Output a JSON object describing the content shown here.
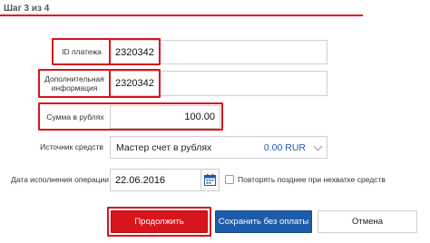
{
  "header": {
    "step": "Шаг 3 из 4"
  },
  "form": {
    "payment_id": {
      "label": "ID платежа",
      "value": "2320342"
    },
    "extra_info": {
      "label": "Дополнительная информация",
      "value": "2320342"
    },
    "amount": {
      "label": "Сумма в рублях",
      "value": "100.00"
    },
    "source": {
      "label": "Источник средств",
      "selected": "Мастер счет в рублях",
      "balance": "0.00 RUR"
    },
    "date": {
      "label": "Дата исполнения операции",
      "value": "22.06.2016"
    },
    "retry": {
      "label": "Повторять позднее при нехватке средств",
      "checked": false
    }
  },
  "buttons": {
    "continue": "Продолжить",
    "save": "Сохранить без оплаты",
    "cancel": "Отмена"
  },
  "colors": {
    "accent": "#d8141c",
    "primary_blue": "#1e5ba8"
  },
  "icons": {
    "calendar": "calendar-icon",
    "dropdown": "chevron-down-icon"
  }
}
